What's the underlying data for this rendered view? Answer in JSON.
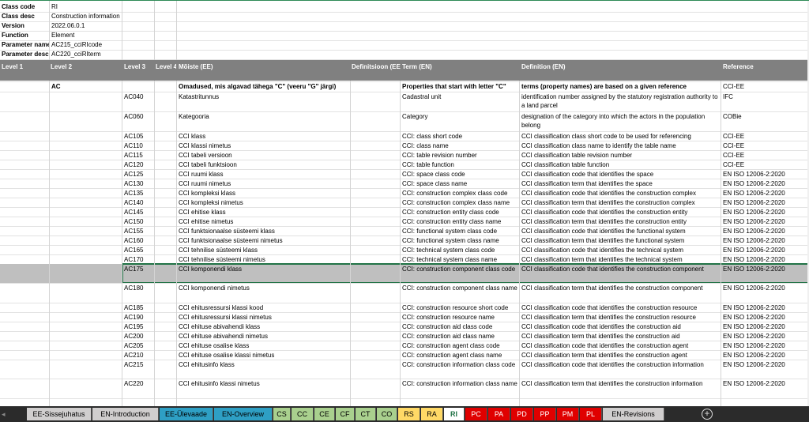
{
  "meta": [
    {
      "label": "Class code",
      "value": "RI"
    },
    {
      "label": "Class desc",
      "value": "Construction information"
    },
    {
      "label": "Version",
      "value": "2022.06.0.1"
    },
    {
      "label": "Function",
      "value": "Element"
    },
    {
      "label": "Parameter name",
      "value": "AC215_cciRIcode"
    },
    {
      "label": "Parameter desc",
      "value": "AC220_cciRIterm"
    }
  ],
  "header": {
    "level1": "Level 1",
    "level2": "Level 2",
    "level3": "Level 3",
    "level4": "Level 4",
    "moiste": "Mõiste (EE)",
    "definitsioon": "Definitsioon (EE)",
    "term": "Term (EN)",
    "definition": "Definition (EN)",
    "reference": "Reference"
  },
  "group": {
    "level2": "AC",
    "moiste": "Omadused, mis algavad tähega \"C\" (veeru \"G\" järgi)",
    "term": "Properties that start with letter \"C\"",
    "definition": "terms (property names) are based on a given reference",
    "reference": "CCI-EE"
  },
  "rows": [
    {
      "code": "AC040",
      "ee": "Katastritunnus",
      "term": "Cadastral unit",
      "def": "identification number assigned by the statutory registration authority to a land parcel",
      "ref": "IFC"
    },
    {
      "code": "AC060",
      "ee": "Kategooria",
      "term": "Category",
      "def": "designation of the category into which the actors in the population belong",
      "ref": "COBie"
    },
    {
      "code": "AC105",
      "ee": "CCI klass",
      "term": "CCI: class short code",
      "def": "CCI classification class short code to be used for referencing",
      "ref": "CCI-EE"
    },
    {
      "code": "AC110",
      "ee": "CCI klassi nimetus",
      "term": "CCI: class name",
      "def": "CCI classification class name to identify the table name",
      "ref": "CCI-EE"
    },
    {
      "code": "AC115",
      "ee": "CCI tabeli versioon",
      "term": "CCI: table revision number",
      "def": "CCI classification table revision number",
      "ref": "CCI-EE"
    },
    {
      "code": "AC120",
      "ee": "CCI tabeli funktsioon",
      "term": "CCI: table function",
      "def": "CCI classification table function",
      "ref": "CCI-EE"
    },
    {
      "code": "AC125",
      "ee": "CCI ruumi klass",
      "term": "CCI: space class code",
      "def": "CCI classification code that identifies the space",
      "ref": "EN ISO 12006-2:2020"
    },
    {
      "code": "AC130",
      "ee": "CCI ruumi nimetus",
      "term": "CCI: space class name",
      "def": "CCI classification term that identifies the space",
      "ref": "EN ISO 12006-2:2020"
    },
    {
      "code": "AC135",
      "ee": "CCI kompleksi klass",
      "term": "CCI: construction complex class code",
      "def": "CCI classification code that identifies the construction complex",
      "ref": "EN ISO 12006-2:2020"
    },
    {
      "code": "AC140",
      "ee": "CCI kompleksi nimetus",
      "term": "CCI: construction complex class name",
      "def": "CCI classification term that identifies the construction complex",
      "ref": "EN ISO 12006-2:2020"
    },
    {
      "code": "AC145",
      "ee": "CCI ehitise klass",
      "term": "CCI: construction entity class code",
      "def": "CCI classification code that identifies the construction entity",
      "ref": "EN ISO 12006-2:2020"
    },
    {
      "code": "AC150",
      "ee": "CCI ehitise nimetus",
      "term": "CCI: construction entity class name",
      "def": "CCI classification term that identifies the construction entity",
      "ref": "EN ISO 12006-2:2020"
    },
    {
      "code": "AC155",
      "ee": "CCI funktsionaalse süsteemi klass",
      "term": "CCI: functional system class code",
      "def": "CCI classification code that identifies the functional system",
      "ref": "EN ISO 12006-2:2020"
    },
    {
      "code": "AC160",
      "ee": "CCI funktsionaalse süsteemi nimetus",
      "term": "CCI: functional system class name",
      "def": "CCI classification term that identifies the functional system",
      "ref": "EN ISO 12006-2:2020"
    },
    {
      "code": "AC165",
      "ee": "CCI tehnilise süsteemi klass",
      "term": "CCI: technical system class code",
      "def": "CCI classification code that identifies the technical system",
      "ref": "EN ISO 12006-2:2020"
    },
    {
      "code": "AC170",
      "ee": "CCI tehnilise süsteemi nimetus",
      "term": "CCI: technical system class name",
      "def": "CCI classification term that identifies the technical system",
      "ref": "EN ISO 12006-2:2020"
    },
    {
      "code": "AC175",
      "ee": "CCI komponendi klass",
      "term": "CCI: construction component class code",
      "def": "CCI classification code that identifies the construction component",
      "ref": "EN ISO 12006-2:2020"
    },
    {
      "code": "AC180",
      "ee": "CCI komponendi nimetus",
      "term": "CCI: construction component class name",
      "def": "CCI classification term that identifies the construction component",
      "ref": "EN ISO 12006-2:2020"
    },
    {
      "code": "AC185",
      "ee": "CCI ehitusressursi klassi kood",
      "term": "CCI: construction resource short code",
      "def": "CCI classification code that identifies the construction resource",
      "ref": "EN ISO 12006-2:2020"
    },
    {
      "code": "AC190",
      "ee": "CCI ehitusressursi klassi nimetus",
      "term": "CCI: construction resource name",
      "def": "CCI classification term that identifies the construction resource",
      "ref": "EN ISO 12006-2:2020"
    },
    {
      "code": "AC195",
      "ee": "CCI ehituse abivahendi klass",
      "term": "CCI: construction aid class code",
      "def": "CCI classification code that identifies the construction aid",
      "ref": "EN ISO 12006-2:2020"
    },
    {
      "code": "AC200",
      "ee": "CCI ehituse abivahendi nimetus",
      "term": "CCI: construction aid class name",
      "def": "CCI classification term that identifies the construction aid",
      "ref": "EN ISO 12006-2:2020"
    },
    {
      "code": "AC205",
      "ee": "CCI ehituse osalise klass",
      "term": "CCI: construction agent class code",
      "def": "CCI classification code that identifies the construction agent",
      "ref": "EN ISO 12006-2:2020"
    },
    {
      "code": "AC210",
      "ee": "CCI ehituse osalise klassi nimetus",
      "term": "CCI: construction agent class name",
      "def": "CCI classification term that identifies the construction agent",
      "ref": "EN ISO 12006-2:2020"
    },
    {
      "code": "AC215",
      "ee": "CCI ehitusinfo klass",
      "term": "CCI: construction information class code",
      "def": "CCI classification code that identifies the construction information",
      "ref": "EN ISO 12006-2:2020"
    },
    {
      "code": "AC220",
      "ee": "CCI ehitusinfo klassi nimetus",
      "term": "CCI: construction information class name",
      "def": "CCI classification term that identifies the construction information",
      "ref": "EN ISO 12006-2:2020"
    }
  ],
  "tabs": [
    {
      "label": "EE-Sissejuhatus",
      "color": "#d0cece",
      "text": "#000000"
    },
    {
      "label": "EN-Introduction",
      "color": "#d0cece",
      "text": "#000000"
    },
    {
      "label": "EE-Ülevaade",
      "color": "#2e9fc4",
      "text": "#000000"
    },
    {
      "label": "EN-Overview",
      "color": "#2e9fc4",
      "text": "#000000"
    },
    {
      "label": "CS",
      "color": "#a9d08e",
      "text": "#000000"
    },
    {
      "label": "CC",
      "color": "#a9d08e",
      "text": "#000000"
    },
    {
      "label": "CE",
      "color": "#a9d08e",
      "text": "#000000"
    },
    {
      "label": "CF",
      "color": "#a9d08e",
      "text": "#000000"
    },
    {
      "label": "CT",
      "color": "#a9d08e",
      "text": "#000000"
    },
    {
      "label": "CO",
      "color": "#a9d08e",
      "text": "#000000"
    },
    {
      "label": "RS",
      "color": "#ffd966",
      "text": "#000000"
    },
    {
      "label": "RA",
      "color": "#ffd966",
      "text": "#000000"
    },
    {
      "label": "RI",
      "color": "#ffffff",
      "text": "#217346",
      "active": true
    },
    {
      "label": "PC",
      "color": "#e00000",
      "text": "#ffffff"
    },
    {
      "label": "PA",
      "color": "#e00000",
      "text": "#ffffff"
    },
    {
      "label": "PD",
      "color": "#e00000",
      "text": "#ffffff"
    },
    {
      "label": "PP",
      "color": "#e00000",
      "text": "#ffffff"
    },
    {
      "label": "PM",
      "color": "#e00000",
      "text": "#ffffff"
    },
    {
      "label": "PL",
      "color": "#e00000",
      "text": "#ffffff"
    },
    {
      "label": "EN-Revisions",
      "color": "#d0cece",
      "text": "#000000"
    }
  ],
  "add_sheet_symbol": "+",
  "nav_symbol": "◂",
  "selected_code": "AC175"
}
